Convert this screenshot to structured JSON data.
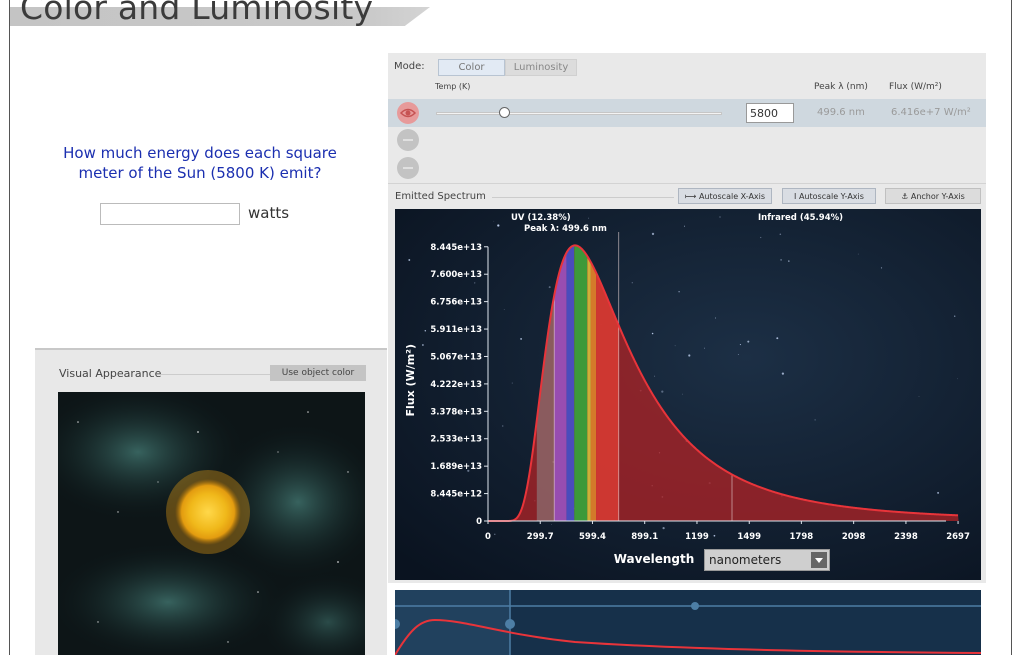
{
  "title": "Color and Luminosity",
  "question": {
    "text": "How much energy does each square meter of the Sun (5800 K) emit?",
    "answer_value": "",
    "unit": "watts"
  },
  "visual_appearance": {
    "title": "Visual Appearance",
    "use_object_color_label": "Use object color",
    "star_color": "#f5c518"
  },
  "controls": {
    "mode_label": "Mode:",
    "mode_options": [
      "Color",
      "Luminosity"
    ],
    "mode_selected": "Color",
    "temp_header": "Temp (K)",
    "peak_header": "Peak λ (nm)",
    "flux_header": "Flux (W/m²)",
    "star": {
      "temperature": "5800",
      "peak_nm": "499.6 nm",
      "flux": "6.416e+7 W/m²",
      "slider_fraction": 0.25
    }
  },
  "spectrum": {
    "title": "Emitted Spectrum",
    "buttons": {
      "autoscale_x": "Autoscale X-Axis",
      "autoscale_y": "Autoscale Y-Axis",
      "anchor_y": "Anchor Y-Axis"
    },
    "unit_selected": "nanometers"
  },
  "chart_data": {
    "type": "area",
    "xlabel": "Wavelength",
    "ylabel": "Flux (W/m²)",
    "x_ticks": [
      "0",
      "299.7",
      "599.4",
      "899.1",
      "1199",
      "1499",
      "1798",
      "2098",
      "2398",
      "2697"
    ],
    "x_tick_values": [
      0,
      299.7,
      599.4,
      899.1,
      1199,
      1499,
      1798,
      2098,
      2398,
      2697
    ],
    "y_ticks": [
      "0",
      "8.445e+12",
      "1.689e+13",
      "2.533e+13",
      "3.378e+13",
      "4.222e+13",
      "5.067e+13",
      "5.911e+13",
      "6.756e+13",
      "7.600e+13",
      "8.445e+13"
    ],
    "y_tick_values": [
      0,
      8445000000000.0,
      16890000000000.0,
      25330000000000.0,
      33780000000000.0,
      42220000000000.0,
      50670000000000.0,
      59110000000000.0,
      67560000000000.0,
      76000000000000.0,
      84450000000000.0
    ],
    "xlim": [
      0,
      2800
    ],
    "ylim": [
      0,
      89000000000000.0
    ],
    "temperature_K": 5800,
    "peak_wavelength_nm": 499.6,
    "annotations": {
      "uv": "UV (12.38%)",
      "peak": "Peak λ: 499.6 nm",
      "infrared": "Infrared (45.94%)"
    },
    "visible_bands": [
      {
        "from": 380,
        "to": 450,
        "color": "#9a55c9"
      },
      {
        "from": 450,
        "to": 495,
        "color": "#3f53d6"
      },
      {
        "from": 495,
        "to": 570,
        "color": "#2fae3c"
      },
      {
        "from": 570,
        "to": 590,
        "color": "#d8c93b"
      },
      {
        "from": 590,
        "to": 620,
        "color": "#e08a2a"
      },
      {
        "from": 620,
        "to": 750,
        "color": "#d93b33"
      }
    ],
    "curve_color": "#e8343a",
    "fill_color": "#a82327"
  }
}
